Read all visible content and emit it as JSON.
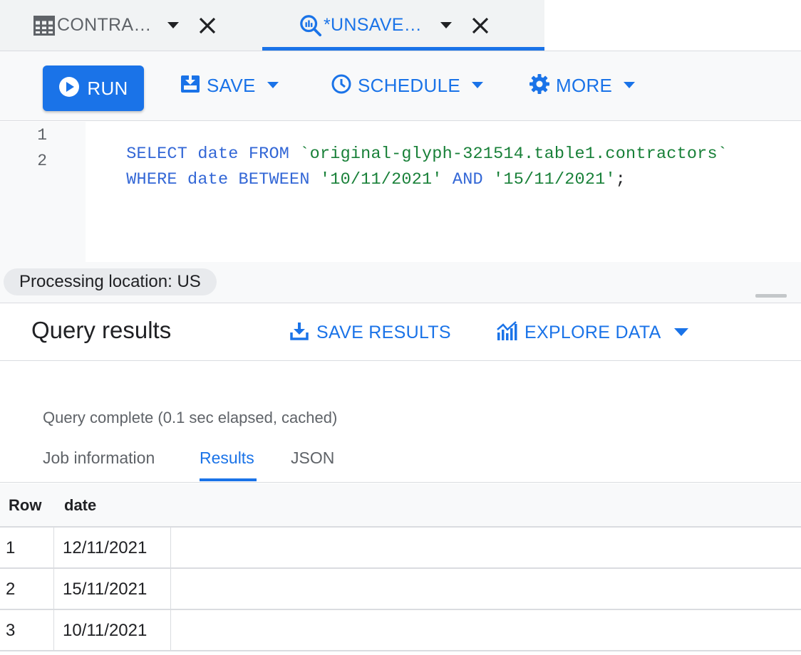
{
  "tabs": [
    {
      "label": "CONTRA…",
      "icon": "table-icon",
      "active": false
    },
    {
      "label": "*UNSAVE…",
      "icon": "query-search-icon",
      "active": true
    }
  ],
  "toolbar": {
    "run_label": "RUN",
    "save_label": "SAVE",
    "schedule_label": "SCHEDULE",
    "more_label": "MORE"
  },
  "editor": {
    "line_numbers": [
      "1",
      "2"
    ],
    "lines": [
      [
        {
          "text": "SELECT date FROM ",
          "kind": "kw"
        },
        {
          "text": "`original-glyph-321514.table1.contractors`",
          "kind": "str"
        }
      ],
      [
        {
          "text": "WHERE date BETWEEN ",
          "kind": "kw"
        },
        {
          "text": "'10/11/2021'",
          "kind": "str"
        },
        {
          "text": " AND ",
          "kind": "kw"
        },
        {
          "text": "'15/11/2021'",
          "kind": "str"
        },
        {
          "text": ";",
          "kind": "plain"
        }
      ]
    ]
  },
  "status": {
    "processing_location": "Processing location: US"
  },
  "results": {
    "title": "Query results",
    "save_results_label": "SAVE RESULTS",
    "explore_data_label": "EXPLORE DATA",
    "complete_message": "Query complete (0.1 sec elapsed, cached)",
    "subtabs": [
      "Job information",
      "Results",
      "JSON"
    ],
    "active_subtab": "Results",
    "table": {
      "columns": [
        "Row",
        "date"
      ],
      "rows": [
        {
          "row": "1",
          "date": "12/11/2021"
        },
        {
          "row": "2",
          "date": "15/11/2021"
        },
        {
          "row": "3",
          "date": "10/11/2021"
        }
      ]
    }
  },
  "colors": {
    "accent": "#1a73e8",
    "keyword": "#3367d6",
    "string": "#188038",
    "muted": "#5f6368"
  }
}
